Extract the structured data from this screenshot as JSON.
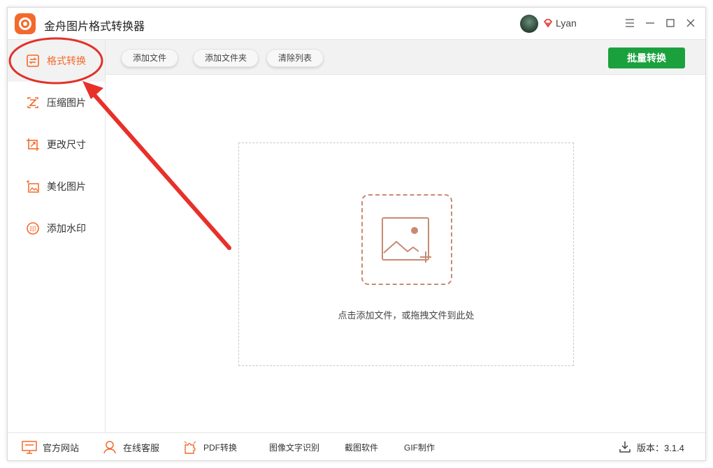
{
  "app": {
    "title": "金舟图片格式转换器",
    "user_name": "Lyan",
    "brand_color": "#f26a2b",
    "accent_green": "#1aa13d"
  },
  "window_controls": {
    "menu_icon": "menu-icon",
    "minimize_icon": "minimize-icon",
    "maximize_icon": "maximize-icon",
    "close_icon": "close-icon"
  },
  "sidebar": {
    "items": [
      {
        "label": "格式转换",
        "icon": "convert-icon",
        "active": true
      },
      {
        "label": "压缩图片",
        "icon": "compress-icon",
        "active": false
      },
      {
        "label": "更改尺寸",
        "icon": "resize-icon",
        "active": false
      },
      {
        "label": "美化图片",
        "icon": "beautify-icon",
        "active": false
      },
      {
        "label": "添加水印",
        "icon": "watermark-icon",
        "active": false
      }
    ]
  },
  "toolbar": {
    "add_file": "添加文件",
    "add_folder": "添加文件夹",
    "clear_list": "清除列表",
    "batch_convert": "批量转换"
  },
  "dropzone": {
    "hint": "点击添加文件，或拖拽文件到此处",
    "icon": "add-image-icon"
  },
  "footer": {
    "official_site": "官方网站",
    "online_service": "在线客服",
    "pdf_convert": "PDF转换",
    "ocr": "图像文字识别",
    "screenshot": "截图软件",
    "gif": "GIF制作",
    "version": "版本：3.1.4"
  }
}
